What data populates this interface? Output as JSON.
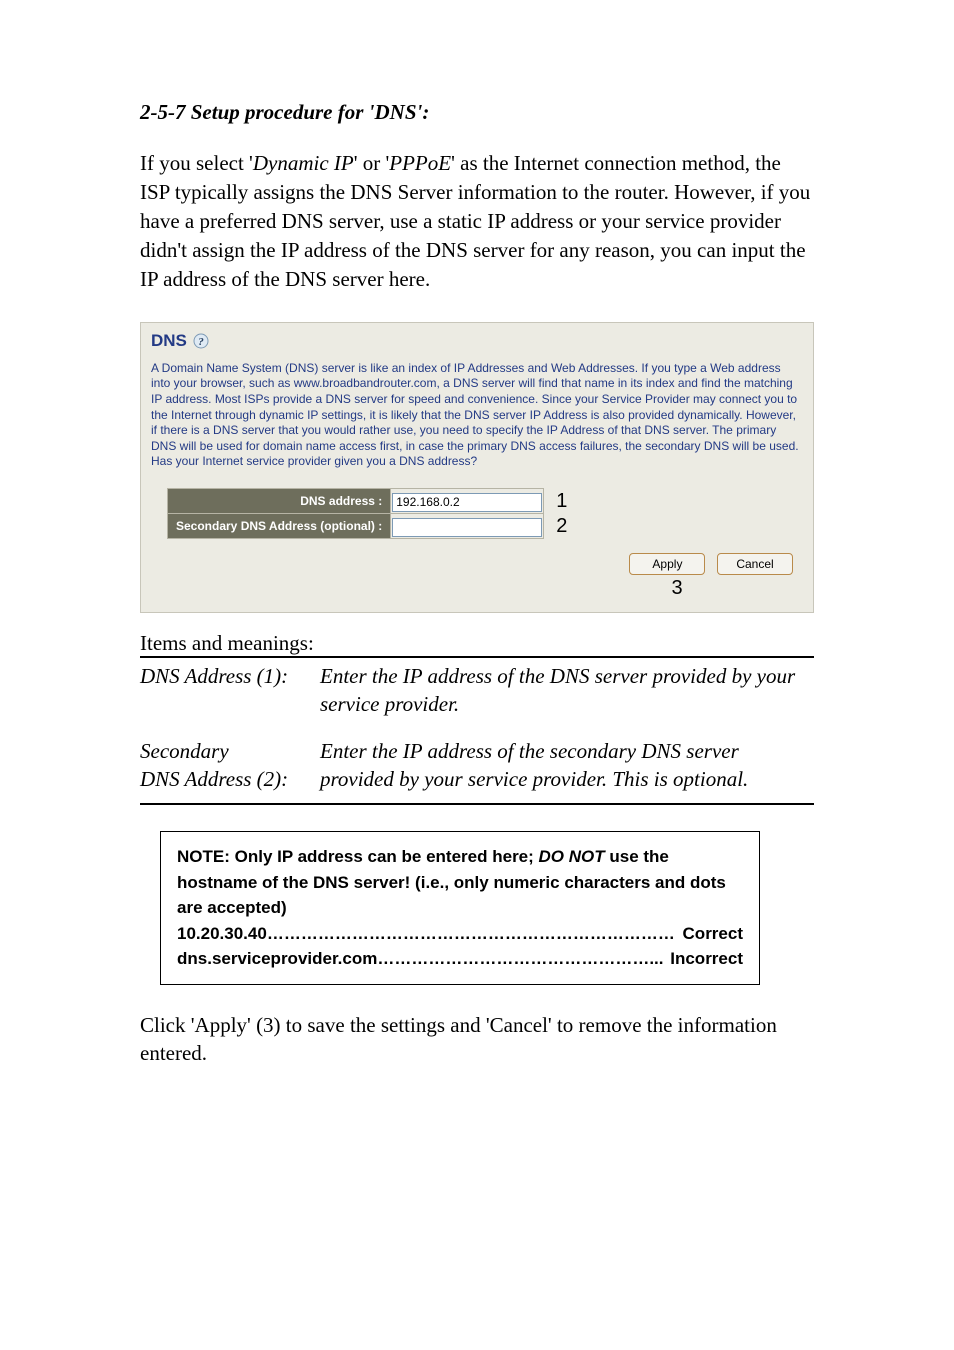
{
  "section_title": "2-5-7 Setup procedure for 'DNS':",
  "intro_para_html": "If you select '<i>Dynamic IP</i>' or '<i>PPPoE</i>' as the Internet connection method, the ISP typically assigns the DNS Server information to the router. However, if you have a preferred DNS server, use a static IP address or your service provider didn't assign the IP address of the DNS server for any reason, you can input the IP address of the DNS server here.",
  "panel": {
    "title": "DNS",
    "help_icon_label": "?",
    "description": "A Domain Name System (DNS) server is like an index of IP Addresses and Web Addresses. If you type a Web address into your browser, such as www.broadbandrouter.com, a DNS server will find that name in its index and find the matching IP address. Most ISPs provide a DNS server for speed and convenience. Since your Service Provider may connect you to the Internet through dynamic IP settings, it is likely that the DNS server IP Address is also provided dynamically. However, if there is a DNS server that you would rather use, you need to specify the IP Address of that DNS server. The primary DNS will be used for domain name access first, in case the primary DNS access failures, the secondary DNS will be used.\nHas your Internet service provider given you a DNS address?",
    "rows": [
      {
        "label": "DNS address :",
        "value": "192.168.0.2",
        "callout": "1"
      },
      {
        "label": "Secondary DNS Address (optional) :",
        "value": "",
        "callout": "2"
      }
    ],
    "buttons": {
      "apply": "Apply",
      "cancel": "Cancel",
      "callout": "3"
    }
  },
  "items_heading": "Items and meanings:",
  "definitions": [
    {
      "term": "DNS Address (1):",
      "desc": "Enter the IP address of the DNS server provided by your service provider."
    },
    {
      "term": "Secondary DNS Address (2):",
      "desc": "Enter the IP address of the secondary DNS server provided by your service provider. This is optional."
    }
  ],
  "definitions_term2_lines": [
    "Secondary",
    "DNS Address (2):"
  ],
  "note": {
    "lead_html": "<b>NOTE: Only IP address can be entered here; <i>DO NOT</i> use the hostname of the DNS server! (i.e., only numeric characters and dots are accepted)</b>",
    "examples": [
      {
        "left": "10.20.30.40",
        "right": "Correct"
      },
      {
        "left": "dns.serviceprovider.com",
        "right": "Incorrect"
      }
    ]
  },
  "closing_para": "Click 'Apply' (3) to save the settings and 'Cancel' to remove the information entered."
}
